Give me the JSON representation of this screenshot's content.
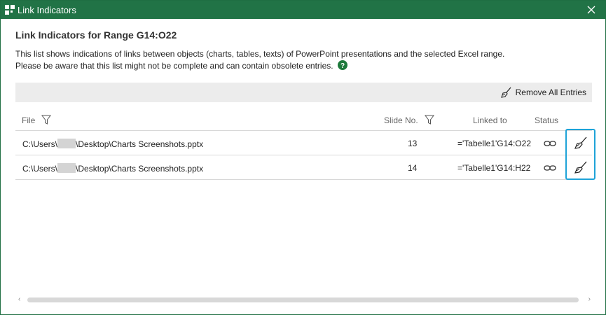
{
  "window": {
    "title": "Link Indicators"
  },
  "header": {
    "heading": "Link Indicators for Range G14:O22",
    "description_line1": "This list shows indications of links between objects (charts, tables, texts) of PowerPoint presentations and the selected Excel range.",
    "description_line2": "Please be aware that this list might not be complete and can contain obsolete entries."
  },
  "toolbar": {
    "remove_all_label": "Remove All Entries"
  },
  "table": {
    "columns": {
      "file": "File",
      "slide_no": "Slide No.",
      "linked_to": "Linked to",
      "status": "Status"
    },
    "rows": [
      {
        "path_prefix": "C:\\Users\\",
        "path_suffix": "\\Desktop\\Charts Screenshots.pptx",
        "slide": "13",
        "linked_to": "='Tabelle1'G14:O22"
      },
      {
        "path_prefix": "C:\\Users\\",
        "path_suffix": "\\Desktop\\Charts Screenshots.pptx",
        "slide": "14",
        "linked_to": "='Tabelle1'G14:H22"
      }
    ]
  },
  "colors": {
    "titlebar": "#217346",
    "highlight": "#1ea3d8",
    "help_icon": "#1e7a3c"
  },
  "icons": [
    "app-logo-icon",
    "close-icon",
    "help-icon",
    "broom-icon",
    "filter-icon",
    "link-icon",
    "chevron-left-icon",
    "chevron-right-icon"
  ]
}
